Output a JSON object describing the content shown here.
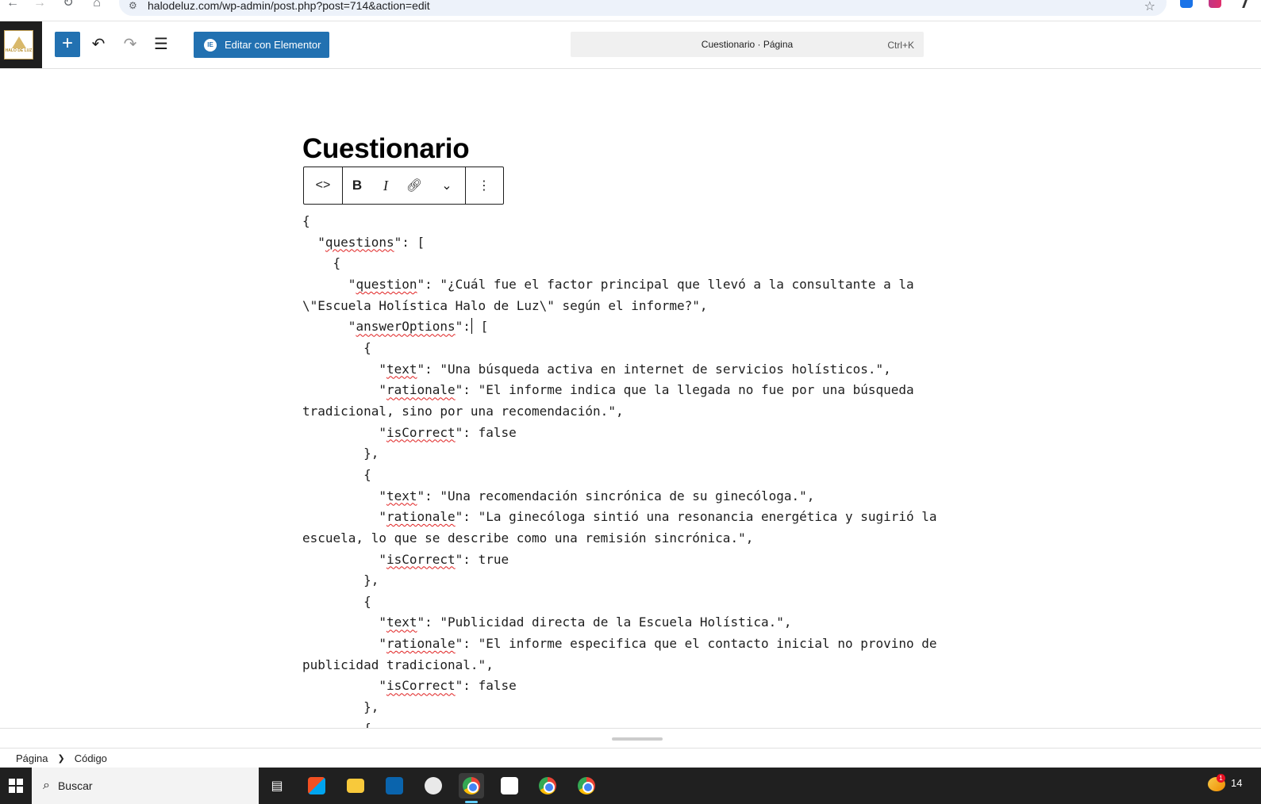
{
  "browser": {
    "url": "halodeluz.com/wp-admin/post.php?post=714&action=edit"
  },
  "editor": {
    "site_logo_text": "HALO DE LUZ",
    "elementor_button_label": "Editar con Elementor",
    "elementor_icon_text": "IE",
    "command_bar_title": "Cuestionario · Página",
    "command_bar_shortcut": "Ctrl+K"
  },
  "post": {
    "title": "Cuestionario"
  },
  "code_lines": [
    "{",
    "  \"questions\": [",
    "    {",
    "      \"question\": \"¿Cuál fue el factor principal que llevó a la consultante a la \\\"Escuela Holística Halo de Luz\\\" según el informe?\",",
    "      \"answerOptions\": [",
    "        {",
    "          \"text\": \"Una búsqueda activa en internet de servicios holísticos.\",",
    "          \"rationale\": \"El informe indica que la llegada no fue por una búsqueda tradicional, sino por una recomendación.\",",
    "          \"isCorrect\": false",
    "        },",
    "        {",
    "          \"text\": \"Una recomendación sincrónica de su ginecóloga.\",",
    "          \"rationale\": \"La ginecóloga sintió una resonancia energética y sugirió la escuela, lo que se describe como una remisión sincrónica.\",",
    "          \"isCorrect\": true",
    "        },",
    "        {",
    "          \"text\": \"Publicidad directa de la Escuela Holística.\",",
    "          \"rationale\": \"El informe especifica que el contacto inicial no provino de publicidad tradicional.\",",
    "          \"isCorrect\": false",
    "        },",
    "        {"
  ],
  "breadcrumb": {
    "items": [
      "Página",
      "Código"
    ]
  },
  "taskbar": {
    "search_label": "Buscar",
    "clock": "14",
    "notification_count": "1"
  }
}
